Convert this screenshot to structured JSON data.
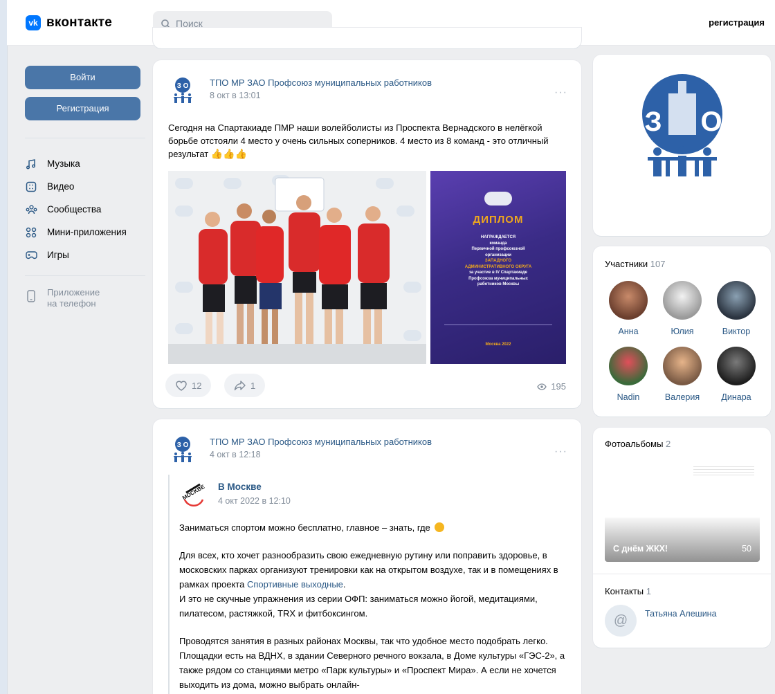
{
  "header": {
    "logo_text": "вконтакте",
    "logo_mark": "vk",
    "search_placeholder": "Поиск",
    "register_link": "регистрация"
  },
  "sidebar": {
    "login_button": "Войти",
    "register_button": "Регистрация",
    "items": [
      {
        "label": "Музыка",
        "icon": "music-icon"
      },
      {
        "label": "Видео",
        "icon": "video-icon"
      },
      {
        "label": "Сообщества",
        "icon": "communities-icon"
      },
      {
        "label": "Мини-приложения",
        "icon": "mini-apps-icon"
      },
      {
        "label": "Игры",
        "icon": "gamepad-icon"
      }
    ],
    "app_line1": "Приложение",
    "app_line2": "на телефон"
  },
  "posts": [
    {
      "author": "ТПО МР ЗАО Профсоюз муниципальных работников",
      "date": "8 окт в 13:01",
      "text": "Сегодня на Спартакиаде ПМР наши волейболисты из Проспекта Вернадского в нелёгкой борьбе отстояли 4 место у очень сильных соперников. 4 место из 8 команд - это отличный результат",
      "emoji": "👍👍👍",
      "diploma": {
        "title": "ДИПЛОМ",
        "line1": "НАГРАЖДАЕТСЯ",
        "line2": "команда",
        "line3": "Первичной профсоюзной",
        "line4": "организации",
        "line5": "ЗАПАДНОГО",
        "line6": "АДМИНИСТРАТИВНОГО ОКРУГА",
        "line7": "за участие в IV Спартакиаде",
        "line8": "Профсоюза муниципальных",
        "line9": "работников Москвы",
        "footer": "Москва 2022"
      },
      "likes": "12",
      "shares": "1",
      "views": "195"
    },
    {
      "author": "ТПО МР ЗАО Профсоюз муниципальных работников",
      "date": "4 окт в 12:18",
      "repost_author": "В Москве",
      "repost_date": "4 окт 2022 в 12:10",
      "p1": "Заниматься спортом можно бесплатно, главное – знать, где",
      "p2a": "Для всех, кто хочет разнообразить свою ежедневную рутину или поправить здоровье, в московских парках организуют тренировки как на открытом воздухе, так и в помещениях в рамках проекта ",
      "p2link": "Спортивные выходные",
      "p2b": ".",
      "p3": "И это не скучные упражнения из серии ОФП: заниматься можно йогой, медитациями, пилатесом, растяжкой, TRX и фитбоксингом.",
      "p4": "Проводятся занятия в разных районах Москвы, так что удобное место подобрать легко. Площадки есть на ВДНХ, в здании Северного речного вокзала, в Доме культуры «ГЭС-2», а также рядом со станциями метро «Парк культуры» и «Проспект Мира». А если не хочется выходить из дома, можно выбрать онлайн-"
    }
  ],
  "right": {
    "logo_label": "ЗАО",
    "members_title": "Участники",
    "members_count": "107",
    "members": [
      "Анна",
      "Юлия",
      "Виктор",
      "Nadin",
      "Валерия",
      "Динара"
    ],
    "albums_title": "Фотоальбомы",
    "albums_count": "2",
    "album_name": "С днём ЖКХ!",
    "album_count": "50",
    "contacts_title": "Контакты",
    "contacts_count": "1",
    "contact_name": "Татьяна Алешина"
  }
}
